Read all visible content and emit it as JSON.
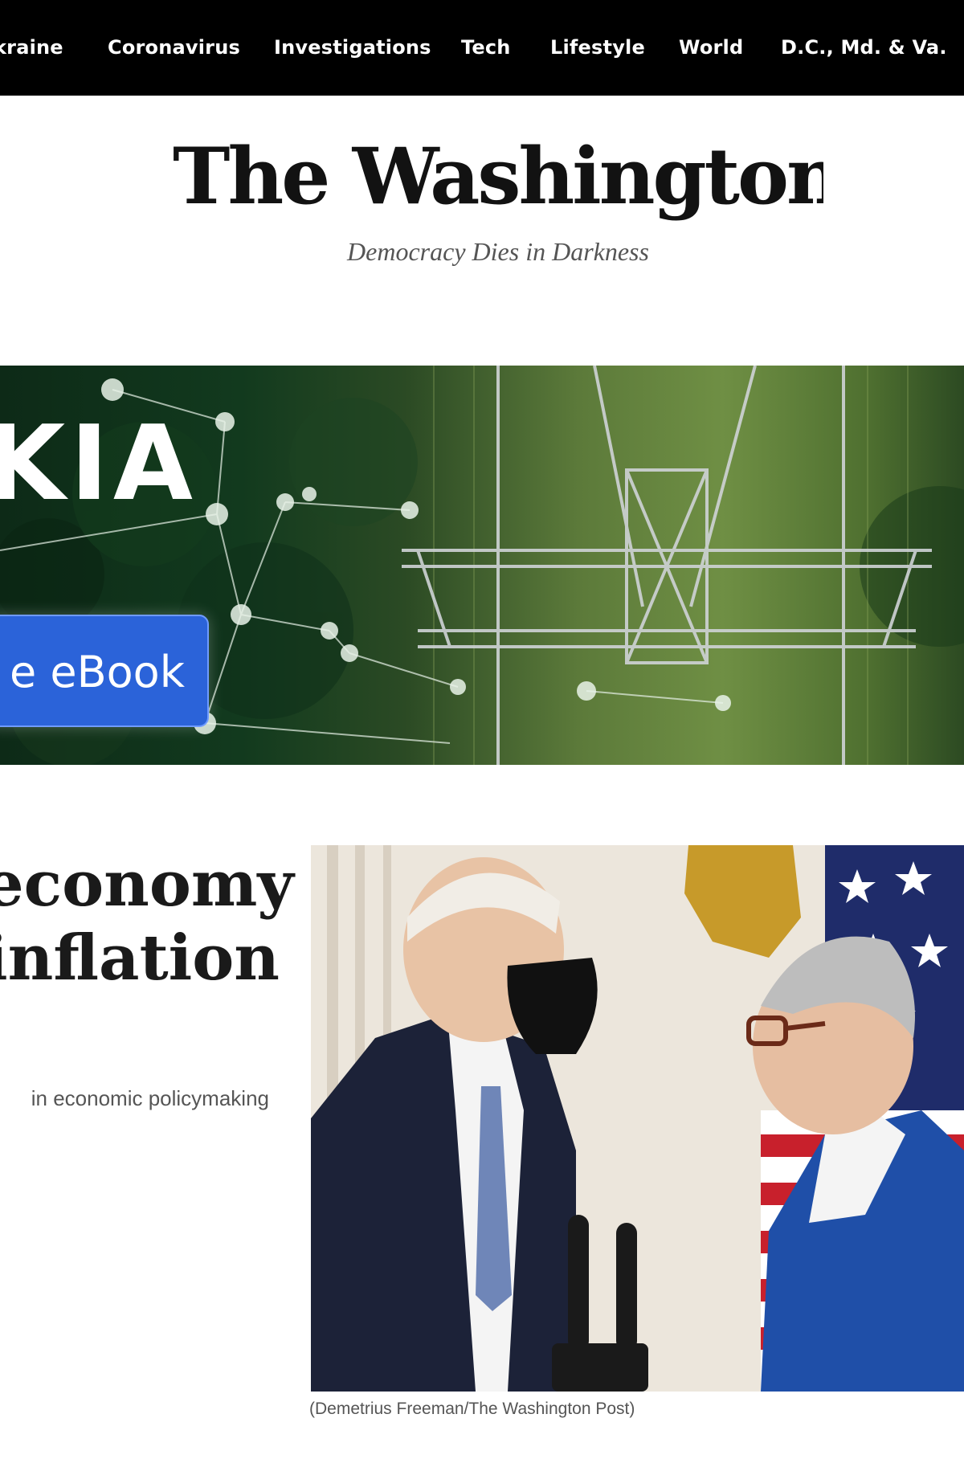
{
  "nav": {
    "items": [
      "kraine",
      "Coronavirus",
      "Investigations",
      "Tech",
      "Lifestyle",
      "World",
      "D.C., Md. & Va."
    ]
  },
  "masthead": {
    "title": "The Washington Post",
    "tagline": "Democracy Dies in Darkness"
  },
  "ad": {
    "brand": "KIA",
    "cta": "e eBook"
  },
  "article": {
    "headline_lines": [
      "economy",
      "inflation"
    ],
    "dek": "in economic policymaking",
    "photo_credit": "(Demetrius Freeman/The Washington Post)"
  }
}
